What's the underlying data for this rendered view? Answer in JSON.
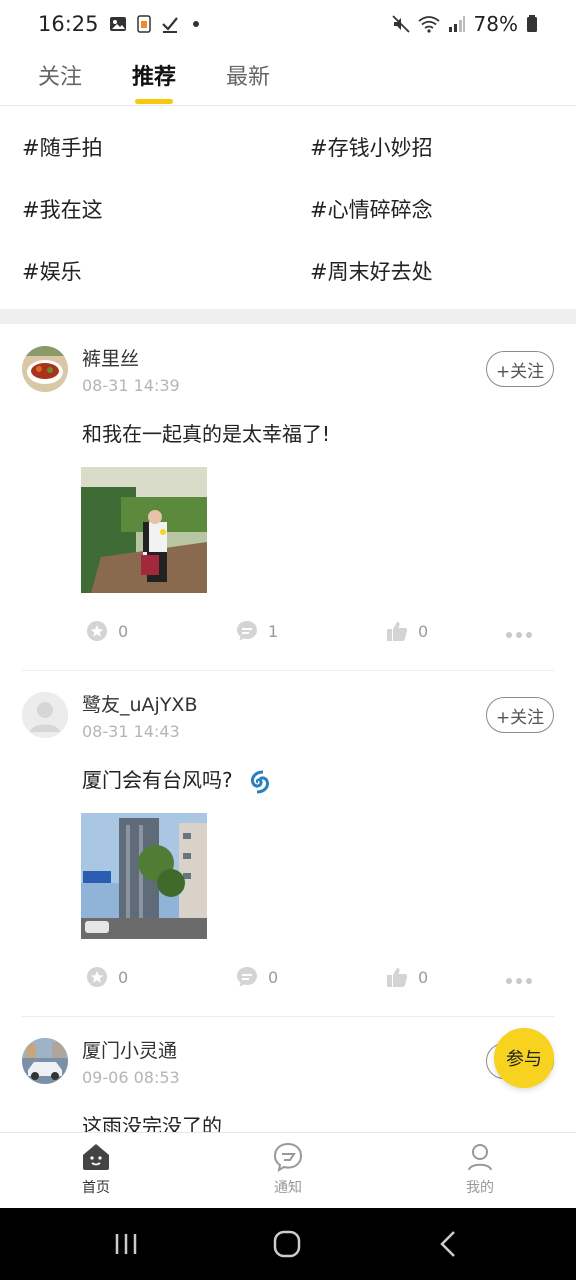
{
  "status_bar": {
    "time": "16:25",
    "battery": "78%",
    "icons_left": [
      "image-icon",
      "app-notification-icon",
      "check-icon",
      "dot-icon"
    ],
    "icons_right": [
      "mute-icon",
      "wifi-icon",
      "signal-icon",
      "battery-icon"
    ]
  },
  "tabs": [
    {
      "label": "关注",
      "active": false
    },
    {
      "label": "推荐",
      "active": true
    },
    {
      "label": "最新",
      "active": false
    }
  ],
  "topics": [
    "#随手拍",
    "#存钱小妙招",
    "#我在这",
    "#心情碎碎念",
    "#娱乐",
    "#周末好去处"
  ],
  "posts": [
    {
      "username": "裤里丝",
      "time": "08-31 14:39",
      "follow_label": "+关注",
      "text": "和我在一起真的是太幸福了!",
      "likes_count": "0",
      "comments_count": "1",
      "thumbs_count": "0"
    },
    {
      "username": "鹭友_uAjYXB",
      "time": "08-31 14:43",
      "follow_label": "+关注",
      "text": "厦门会有台风吗?",
      "likes_count": "0",
      "comments_count": "0",
      "thumbs_count": "0"
    },
    {
      "username": "厦门小灵通",
      "time": "09-06 08:53",
      "follow_label": "+关注",
      "text": "这雨没完没了的"
    }
  ],
  "fab": {
    "label": "参与"
  },
  "bottom_nav": [
    {
      "label": "首页",
      "icon": "home-icon",
      "active": true
    },
    {
      "label": "通知",
      "icon": "notification-icon",
      "active": false
    },
    {
      "label": "我的",
      "icon": "profile-icon",
      "active": false
    }
  ],
  "colors": {
    "accent": "#f7c90c",
    "fab": "#f7d21e",
    "muted_text": "#b5b5b5"
  }
}
